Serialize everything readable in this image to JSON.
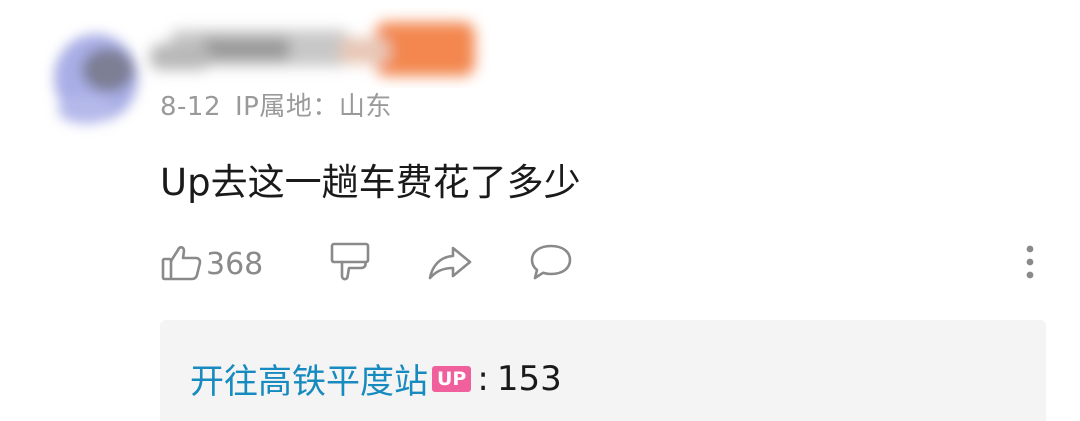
{
  "comment": {
    "date": "8-12",
    "ip_location": "IP属地：山东",
    "text": "Up去这一趟车费花了多少",
    "like_count": "368"
  },
  "icons": {
    "like": "thumbs-up-icon",
    "dislike": "thumbs-down-icon",
    "share": "share-icon",
    "reply": "comment-bubble-icon",
    "more": "more-vertical-icon"
  },
  "reply": {
    "user": "开往高铁平度站",
    "badge": "UP",
    "separator": ":",
    "text": "153"
  },
  "colors": {
    "link": "#178bbf",
    "badge": "#f0609c",
    "meta": "#9a9a9a",
    "reply_bg": "#f4f4f4"
  }
}
